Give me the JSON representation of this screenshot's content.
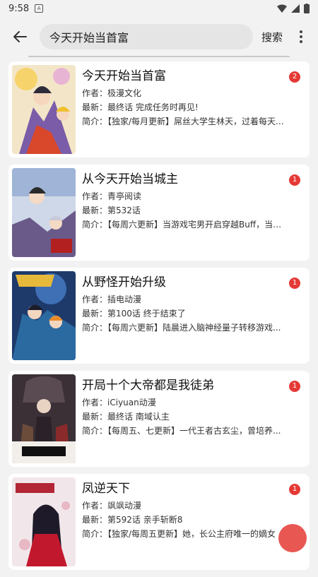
{
  "status": {
    "time": "9:58"
  },
  "header": {
    "search_value": "今天开始当首富",
    "search_label": "搜索"
  },
  "labels": {
    "author": "作者：",
    "latest": "最新：",
    "intro": "简介："
  },
  "results": [
    {
      "title": "今天开始当首富",
      "author": "极漫文化",
      "latest": "最终话 完成任务时再见!",
      "intro": "【独家/每月更新】屌丝大学生林天，过着每天...",
      "badge": "2"
    },
    {
      "title": "从今天开始当城主",
      "author": "青亭阅读",
      "latest": "第532话",
      "intro": "【每周六更新】当游戏宅男开启穿越Buff，当然...",
      "badge": "1"
    },
    {
      "title": "从野怪开始升级",
      "author": "插电动漫",
      "latest": "第100话 终于结束了",
      "intro": "【每周六更新】陆晨进入脑神经量子转移游戏...",
      "badge": "1"
    },
    {
      "title": "开局十个大帝都是我徒弟",
      "author": "iCiyuan动漫",
      "latest": "最终话 南域认主",
      "intro": "【每周五、七更新】一代王者古玄尘，曾培养...",
      "badge": "1"
    },
    {
      "title": "凤逆天下",
      "author": "飒飒动漫",
      "latest": "第592话 亲手斩断8",
      "intro": "【独家/每周五更新】她，长公主府唯一的嫡女",
      "badge": "1"
    }
  ],
  "colors": {
    "accent": "#e53935",
    "background": "#f2f2f2",
    "card": "#ffffff"
  }
}
